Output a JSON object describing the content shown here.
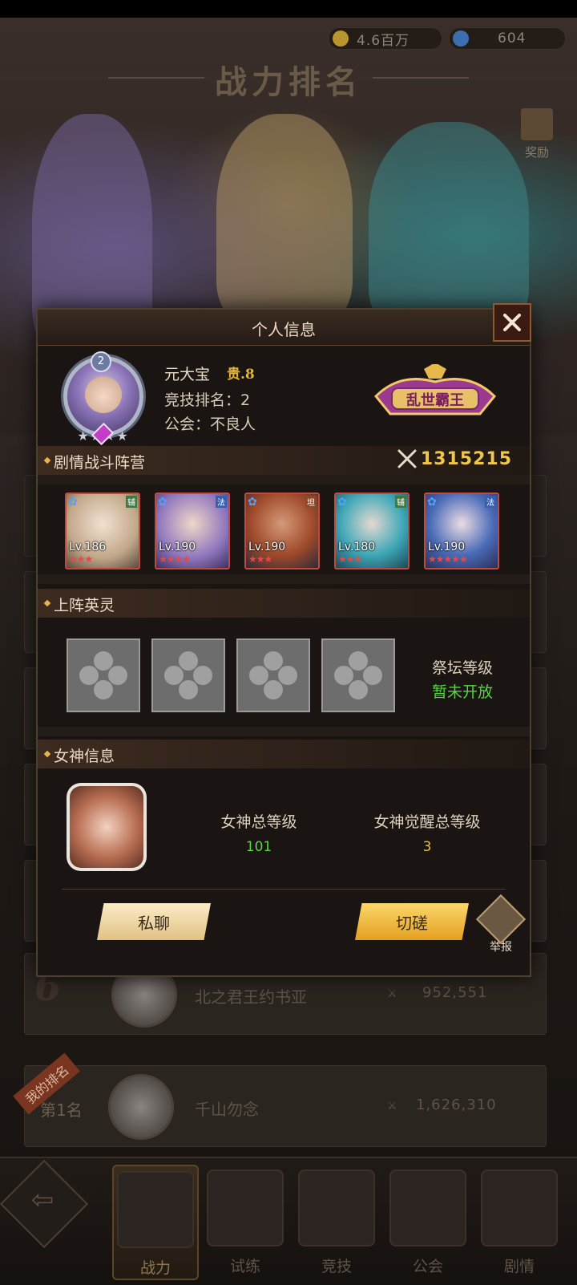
{
  "currency": {
    "gold": "4.6百万",
    "gems": "604"
  },
  "background": {
    "title": "战力排名",
    "reward_label": "奖励",
    "rows": [
      {
        "rank": "6",
        "name": "北之君王约书亚",
        "power": "952,551"
      },
      {
        "rank": "第1名",
        "name": "千山勿念",
        "power": "1,626,310"
      }
    ],
    "my_rank_tag": "我的排名"
  },
  "nav": {
    "items": [
      {
        "label": "战力",
        "icon": "power-ranking-icon",
        "active": true
      },
      {
        "label": "试练",
        "icon": "trial-icon",
        "active": false
      },
      {
        "label": "竞技",
        "icon": "arena-icon",
        "active": false
      },
      {
        "label": "公会",
        "icon": "guild-icon",
        "active": false
      },
      {
        "label": "剧情",
        "icon": "story-icon",
        "active": false
      }
    ]
  },
  "dialog": {
    "title": "个人信息",
    "profile": {
      "avatar_level": "2",
      "name": "元大宝",
      "vip": "贵.8",
      "arena_rank_label": "竞技排名：",
      "arena_rank": "2",
      "guild_label": "公会：",
      "guild": "不良人",
      "title_badge": "乱世霸王"
    },
    "story_team": {
      "label": "剧情战斗阵营",
      "power": "1315215",
      "heroes": [
        {
          "level": "Lv.186",
          "stars": 3,
          "tag": "辅"
        },
        {
          "level": "Lv.190",
          "stars": 4,
          "tag": "法"
        },
        {
          "level": "Lv.190",
          "stars": 3,
          "tag": "坦"
        },
        {
          "level": "Lv.180",
          "stars": 3,
          "tag": "辅"
        },
        {
          "level": "Lv.190",
          "stars": 5,
          "tag": "法"
        }
      ]
    },
    "spirits": {
      "label": "上阵英灵",
      "altar_label": "祭坛等级",
      "altar_value": "暂未开放"
    },
    "goddess": {
      "label": "女神信息",
      "total_level_label": "女神总等级",
      "total_level": "101",
      "awaken_label": "女神觉醒总等级",
      "awaken_level": "3"
    },
    "buttons": {
      "chat": "私聊",
      "duel": "切磋",
      "report": "举报"
    }
  },
  "colors": {
    "gold_accent": "#f2c64a",
    "green_value": "#57d642",
    "yellow_value": "#e6c33a"
  }
}
